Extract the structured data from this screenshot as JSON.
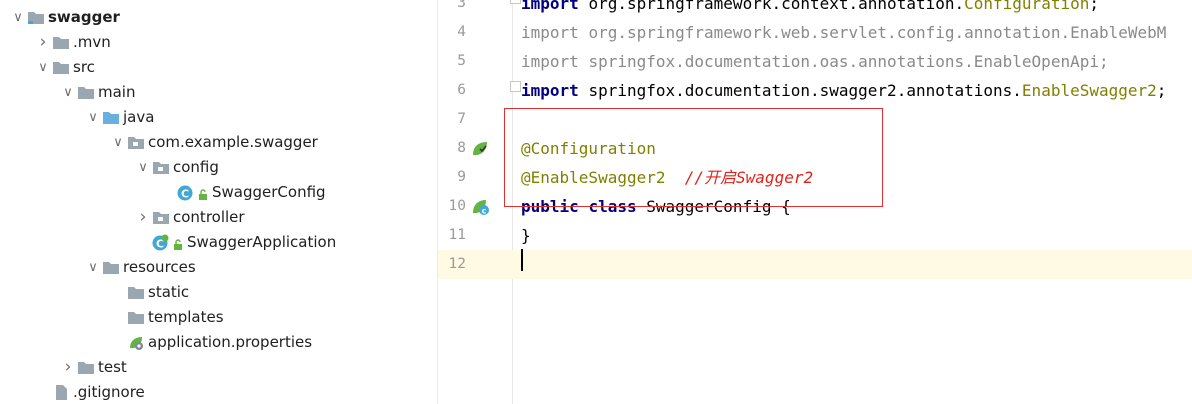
{
  "project_tree": {
    "items": [
      {
        "label": "swagger",
        "depth": 0,
        "bold": true,
        "expanded": true,
        "icon": "project-module-icon"
      },
      {
        "label": ".mvn",
        "depth": 1,
        "expanded": false,
        "icon": "folder-icon"
      },
      {
        "label": "src",
        "depth": 1,
        "expanded": true,
        "icon": "folder-icon"
      },
      {
        "label": "main",
        "depth": 2,
        "expanded": true,
        "icon": "folder-icon"
      },
      {
        "label": "java",
        "depth": 3,
        "expanded": true,
        "icon": "source-folder-icon"
      },
      {
        "label": "com.example.swagger",
        "depth": 4,
        "expanded": true,
        "icon": "package-icon"
      },
      {
        "label": "config",
        "depth": 5,
        "expanded": true,
        "icon": "package-icon"
      },
      {
        "label": "SwaggerConfig",
        "depth": 6,
        "icon": "java-class-icon"
      },
      {
        "label": "controller",
        "depth": 5,
        "expanded": false,
        "icon": "package-icon"
      },
      {
        "label": "SwaggerApplication",
        "depth": 5,
        "icon": "spring-boot-class-icon"
      },
      {
        "label": "resources",
        "depth": 3,
        "expanded": true,
        "icon": "resources-folder-icon"
      },
      {
        "label": "static",
        "depth": 4,
        "icon": "folder-icon"
      },
      {
        "label": "templates",
        "depth": 4,
        "icon": "folder-icon"
      },
      {
        "label": "application.properties",
        "depth": 4,
        "icon": "spring-properties-icon"
      },
      {
        "label": "test",
        "depth": 2,
        "expanded": false,
        "icon": "folder-icon"
      },
      {
        "label": ".gitignore",
        "depth": 1,
        "icon": "ignore-file-icon"
      }
    ]
  },
  "editor": {
    "lines": [
      {
        "n": "3",
        "segments": [
          {
            "t": "import ",
            "c": "kw"
          },
          {
            "t": "org.springframework.context.annotation.",
            "c": ""
          },
          {
            "t": "Configuration",
            "c": "ann"
          },
          {
            "t": ";",
            "c": ""
          }
        ]
      },
      {
        "n": "4",
        "segments": [
          {
            "t": "import ",
            "c": "imp"
          },
          {
            "t": "org.springframework.web.servlet.config.annotation.EnableWebM",
            "c": "imp"
          }
        ]
      },
      {
        "n": "5",
        "segments": [
          {
            "t": "import ",
            "c": "imp"
          },
          {
            "t": "springfox.documentation.oas.annotations.EnableOpenApi;",
            "c": "imp"
          }
        ]
      },
      {
        "n": "6",
        "segments": [
          {
            "t": "import ",
            "c": "kw"
          },
          {
            "t": "springfox.documentation.swagger2.annotations.",
            "c": ""
          },
          {
            "t": "EnableSwagger2",
            "c": "ann"
          },
          {
            "t": ";",
            "c": ""
          }
        ]
      },
      {
        "n": "7",
        "segments": []
      },
      {
        "n": "8",
        "segments": [
          {
            "t": "@Configuration",
            "c": "ann"
          }
        ]
      },
      {
        "n": "9",
        "segments": [
          {
            "t": "@EnableSwagger2",
            "c": "ann"
          },
          {
            "t": "  ",
            "c": ""
          },
          {
            "t": "//开启Swagger2",
            "c": "cmt"
          }
        ]
      },
      {
        "n": "10",
        "segments": [
          {
            "t": "public ",
            "c": "kw"
          },
          {
            "t": "class ",
            "c": "kw"
          },
          {
            "t": "SwaggerConfig {",
            "c": ""
          }
        ]
      },
      {
        "n": "11",
        "segments": [
          {
            "t": "}",
            "c": ""
          }
        ]
      },
      {
        "n": "12",
        "segments": []
      }
    ],
    "current_line": "12",
    "colors": {
      "keyword": "#000080",
      "annotation": "#808000",
      "comment": "#e2211c",
      "highlight_box": "#e03030"
    }
  }
}
